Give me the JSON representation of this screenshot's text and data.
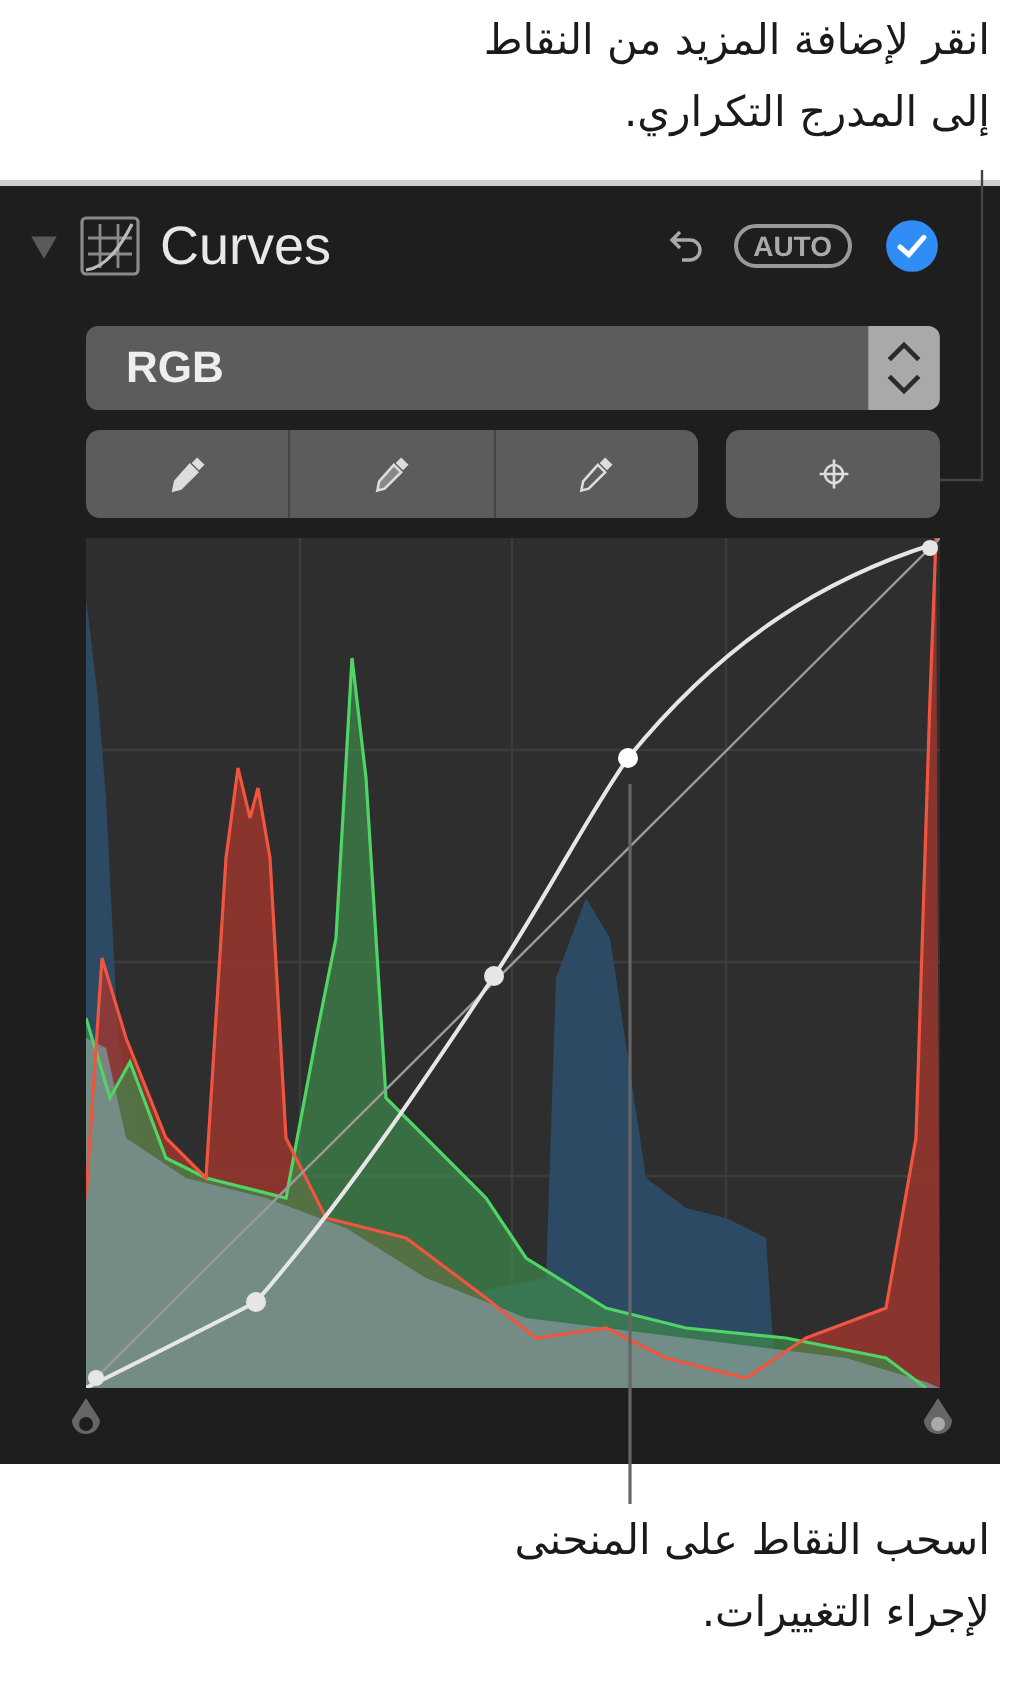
{
  "callouts": [
    {
      "text": "انقر لإضافة المزيد من النقاط\nإلى المدرج التكراري."
    },
    {
      "text": "اسحب النقاط على المنحنى\nلإجراء التغييرات."
    }
  ],
  "panel": {
    "title": "Curves",
    "expanded": true,
    "enabled": true,
    "auto_label": "AUTO",
    "channel": "RGB"
  }
}
